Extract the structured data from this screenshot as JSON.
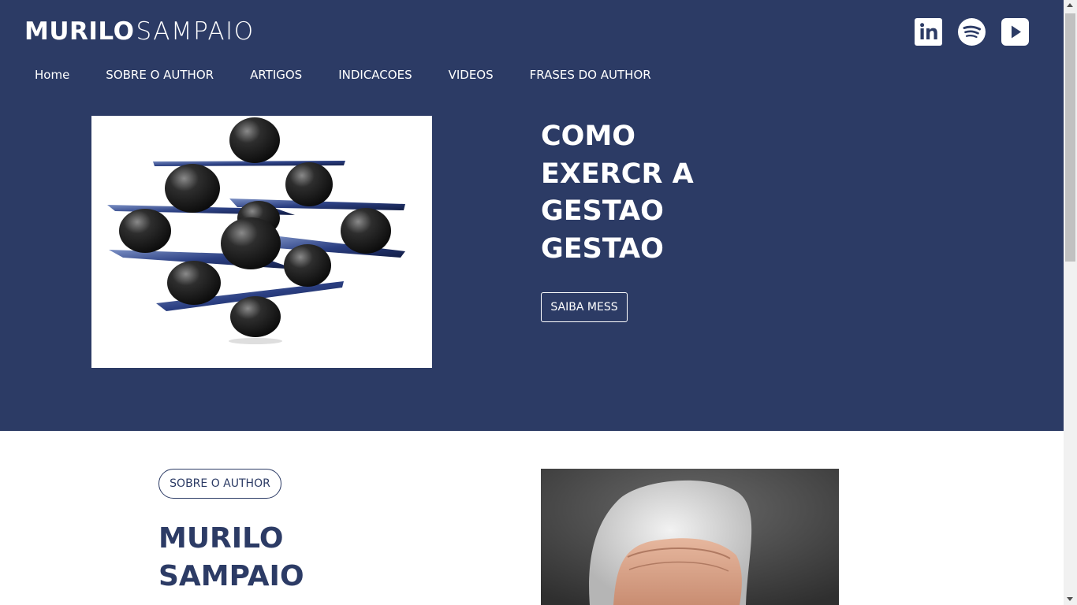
{
  "brand": {
    "bold": "MURILO",
    "light": "SAMPAIO"
  },
  "socials": [
    {
      "name": "linkedin",
      "icon": "linkedin-icon"
    },
    {
      "name": "spotify",
      "icon": "spotify-icon"
    },
    {
      "name": "youtube",
      "icon": "youtube-play-icon"
    }
  ],
  "nav": {
    "items": [
      "Home",
      "SOBRE O AUTHOR",
      "ARTIGOS",
      "INDICACOES",
      "VIDEOS",
      "FRASES DO AUTHOR"
    ]
  },
  "hero": {
    "title_lines": [
      "COMO",
      "EXERCR A",
      "GESTAO",
      "GESTAO"
    ],
    "cta_label": "SAIBA MESS",
    "image": "balance-spheres-image"
  },
  "about": {
    "badge": "SOBRE O AUTHOR",
    "title_lines": [
      "MURILO",
      "SAMPAIO"
    ],
    "image": "author-portrait-image"
  },
  "colors": {
    "primary": "#2c3b65",
    "white": "#ffffff"
  }
}
